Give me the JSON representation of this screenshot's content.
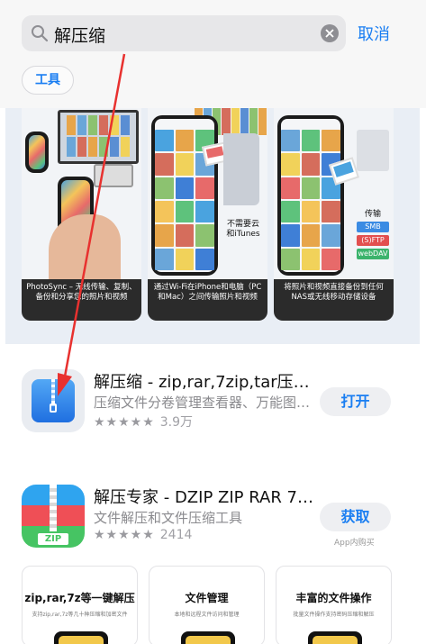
{
  "search": {
    "query": "解压缩",
    "cancel_label": "取消"
  },
  "filter": {
    "chip_label": "工具"
  },
  "screenshots": [
    {
      "caption": "PhotoSync – 无线传输、复制、备份和分享您的照片和视频"
    },
    {
      "caption": "通过Wi-Fi在iPhone和电脑（PC和Mac）之间传输照片和视频",
      "overlay": "不需要云和iTunes"
    },
    {
      "caption": "将照片和视频直接备份到任何NAS或无线移动存储设备",
      "overlay_title": "传输",
      "tags": [
        "SMB",
        "(S)FTP",
        "webDAV"
      ]
    }
  ],
  "apps": [
    {
      "title": "解压缩 - zip,rar,7zip,tar压…",
      "subtitle": "压缩文件分卷管理查看器、万能图…",
      "stars": "★★★★★",
      "rating_count": "3.9万",
      "button_label": "打开",
      "in_app_purchase": ""
    },
    {
      "title": "解压专家 - DZIP ZIP RAR 7…",
      "subtitle": "文件解压和文件压缩工具",
      "stars": "★★★★★",
      "rating_count": "2414",
      "button_label": "获取",
      "in_app_purchase": "App内购买",
      "icon_label": "ZIP"
    }
  ],
  "previews": [
    {
      "title": "zip,rar,7z等一键解压",
      "subtitle": "支持zip,rar,7z等几十种压缩和加密文件"
    },
    {
      "title": "文件管理",
      "subtitle": "本地和远程文件访问和管理"
    },
    {
      "title": "丰富的文件操作",
      "subtitle": "批量文件操作支持密码压缩和解压"
    }
  ],
  "colors": {
    "accent": "#1a7ef2",
    "annotation": "#e8312f"
  }
}
